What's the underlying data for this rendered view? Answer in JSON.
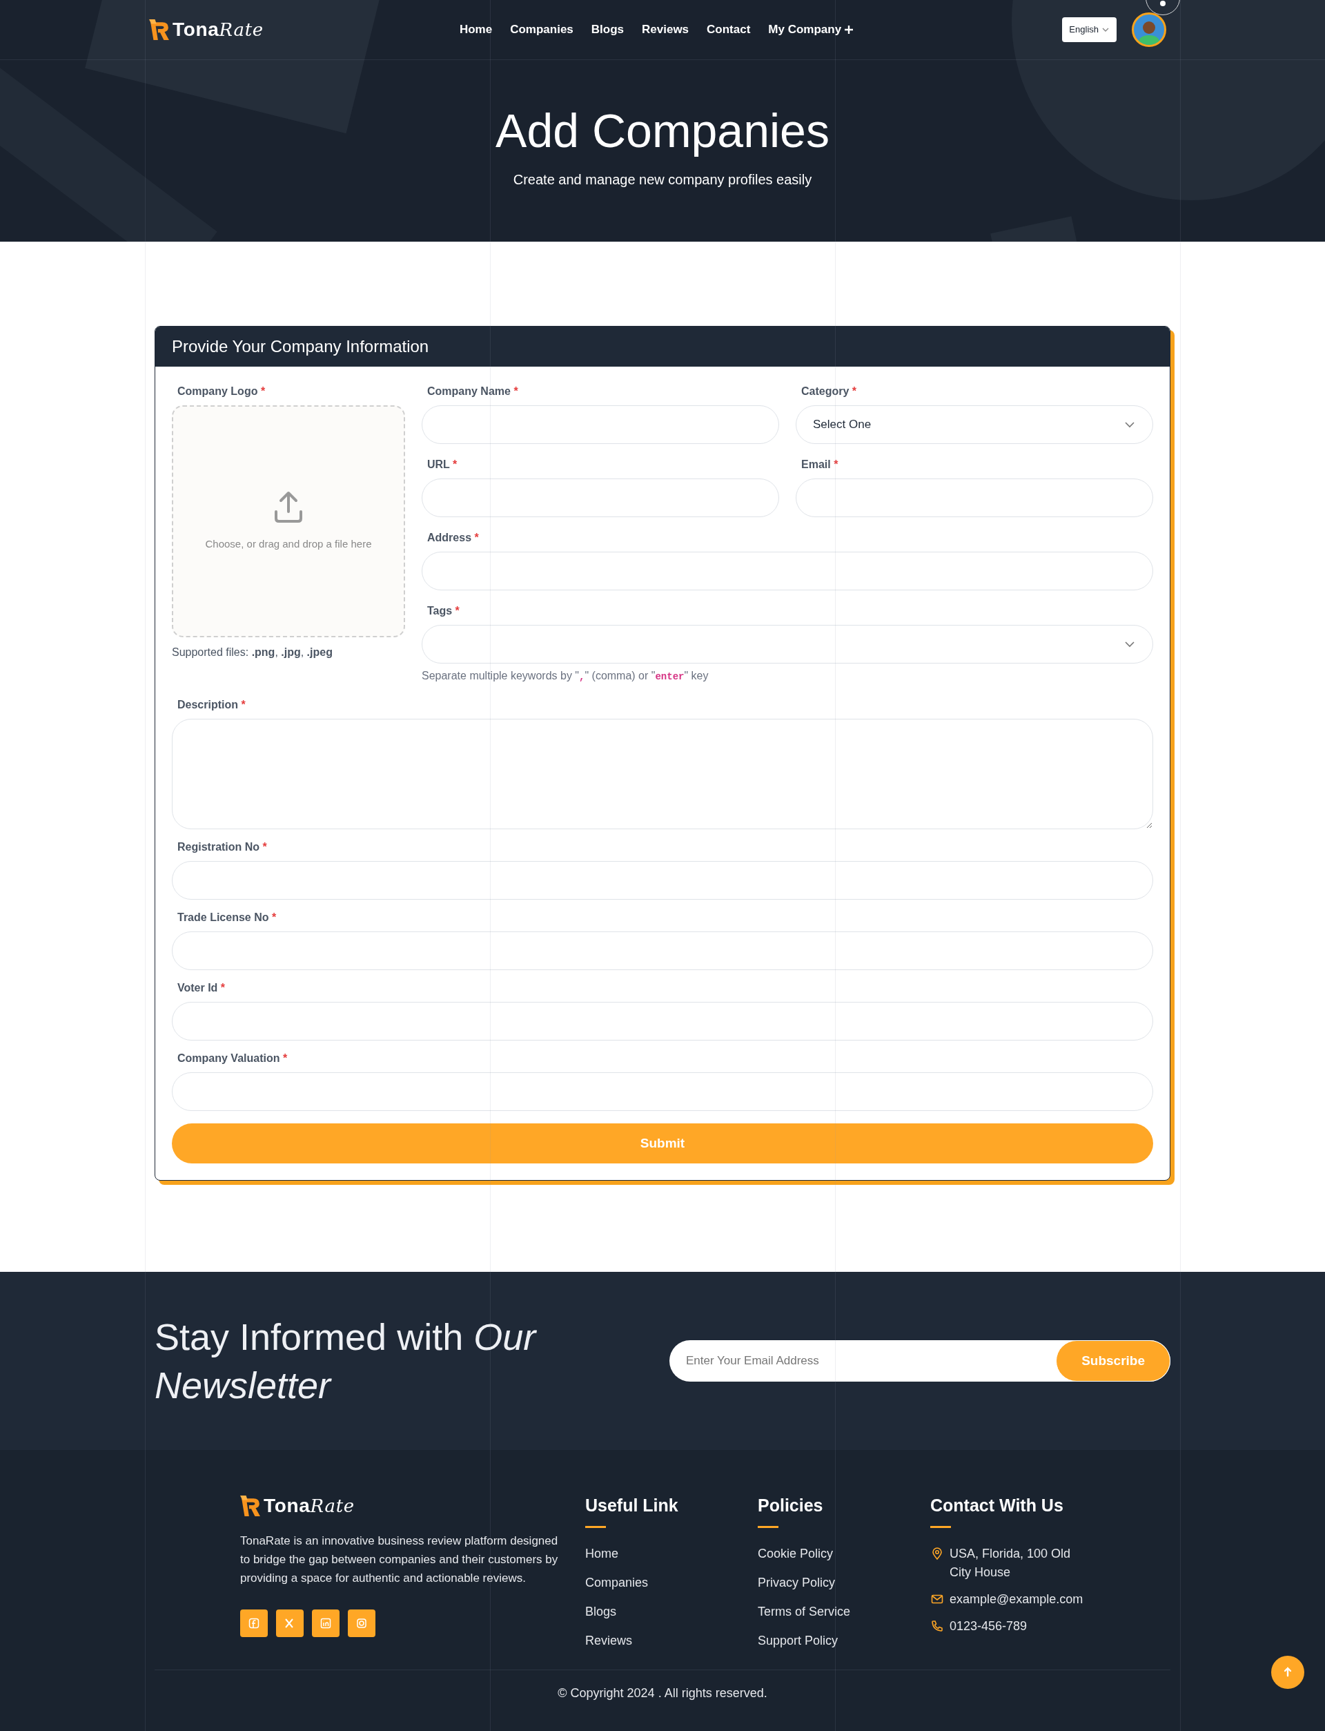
{
  "header": {
    "logo": {
      "name": "Tona",
      "accent": "Rate"
    },
    "nav": [
      {
        "label": "Home",
        "kind": "link"
      },
      {
        "label": "Companies",
        "kind": "link"
      },
      {
        "label": "Blogs",
        "kind": "link"
      },
      {
        "label": "Reviews",
        "kind": "link"
      },
      {
        "label": "Contact",
        "kind": "link"
      },
      {
        "label": "My Company",
        "kind": "menu"
      }
    ],
    "language": "English"
  },
  "hero": {
    "title": "Add Companies",
    "subtitle": "Create and manage new company profiles easily"
  },
  "form": {
    "title": "Provide Your Company Information",
    "required_mark": "*",
    "logo_field": {
      "label": "Company Logo",
      "required": true,
      "hint": "Choose, or drag and drop a file here",
      "supported": "Supported files: **.png**, **.jpg**, **.jpeg**"
    },
    "top_rows": [
      [
        {
          "label": "Company Name",
          "required": true,
          "kind": "input"
        },
        {
          "label": "Category",
          "required": true,
          "kind": "select",
          "value": "Select One"
        }
      ],
      [
        {
          "label": "URL",
          "required": true,
          "kind": "input"
        },
        {
          "label": "Email",
          "required": true,
          "kind": "input"
        }
      ],
      [
        {
          "label": "Address",
          "required": true,
          "kind": "input"
        }
      ],
      [
        {
          "label": "Tags",
          "required": true,
          "kind": "select",
          "help": [
            {
              "kind": "text",
              "text": "Separate multiple keywords by \""
            },
            {
              "kind": "code",
              "text": ","
            },
            {
              "kind": "text",
              "text": "\" (comma) or \""
            },
            {
              "kind": "code",
              "text": "enter"
            },
            {
              "kind": "text",
              "text": "\" key"
            }
          ]
        }
      ]
    ],
    "fields": [
      {
        "label": "Description",
        "required": true,
        "kind": "textarea"
      },
      {
        "label": "Registration No",
        "required": true,
        "kind": "input"
      },
      {
        "label": "Trade License No",
        "required": true,
        "kind": "input"
      },
      {
        "label": "Voter Id",
        "required": true,
        "kind": "input"
      },
      {
        "label": "Company Valuation",
        "required": true,
        "kind": "input"
      }
    ],
    "submit": "Submit"
  },
  "newsletter": {
    "heading": "Stay Informed with *Our Newsletter*",
    "placeholder": "Enter Your Email Address",
    "button": "Subscribe"
  },
  "footer": {
    "logo": {
      "name": "Tona",
      "accent": "Rate"
    },
    "about": "TonaRate is an innovative business review platform designed to bridge the gap between companies and their customers by providing a space for authentic and actionable reviews.",
    "socials": [
      {
        "kind": "facebook"
      },
      {
        "kind": "x"
      },
      {
        "kind": "linkedin"
      },
      {
        "kind": "instagram"
      }
    ],
    "columns": [
      {
        "title": "Useful Link",
        "links": [
          "Home",
          "Companies",
          "Blogs",
          "Reviews"
        ]
      },
      {
        "title": "Policies",
        "links": [
          "Cookie Policy",
          "Privacy Policy",
          "Terms of Service",
          "Support Policy"
        ]
      }
    ],
    "contact": {
      "title": "Contact With Us",
      "items": [
        {
          "kind": "location",
          "text": "USA, Florida, 100 Old City House"
        },
        {
          "kind": "email",
          "text": "example@example.com"
        },
        {
          "kind": "phone",
          "text": "0123-456-789"
        }
      ]
    },
    "copyright": "© Copyright 2024 . All rights reserved."
  }
}
